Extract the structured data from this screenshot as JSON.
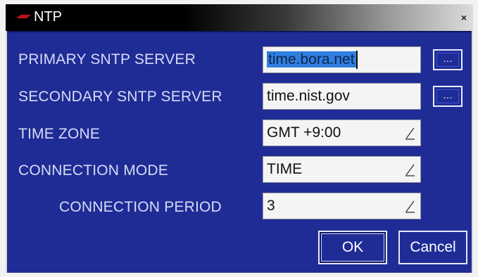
{
  "window": {
    "title": "NTP",
    "close_glyph": "×"
  },
  "fields": {
    "primary_sntp_server": {
      "label": "PRIMARY SNTP SERVER",
      "value": "time.bora.net"
    },
    "secondary_sntp_server": {
      "label": "SECONDARY SNTP SERVER",
      "value": "time.nist.gov"
    },
    "time_zone": {
      "label": "TIME ZONE",
      "value": "GMT +9:00"
    },
    "connection_mode": {
      "label": "CONNECTION MODE",
      "value": "TIME"
    },
    "connection_period": {
      "label": "CONNECTION PERIOD",
      "value": "3"
    }
  },
  "browse_label": "…",
  "buttons": {
    "ok": "OK",
    "cancel": "Cancel"
  },
  "colors": {
    "panel": "#1f2c96",
    "label_text": "#d7dbf4",
    "selection": "#2f7fe0"
  }
}
